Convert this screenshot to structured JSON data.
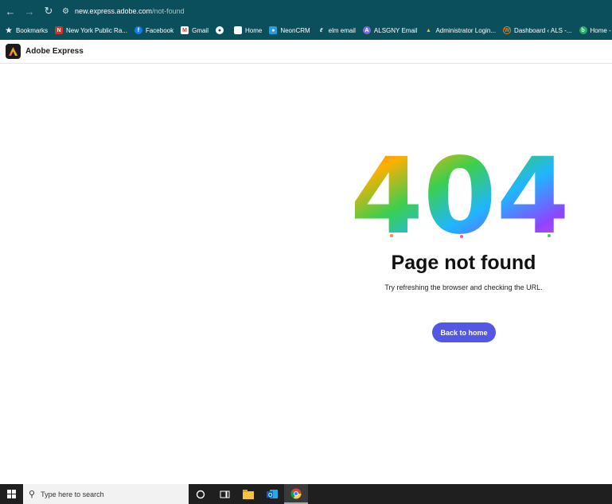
{
  "browser": {
    "url_host": "new.express.adobe.com",
    "url_path": "/not-found",
    "bookmarks": [
      {
        "label": "Bookmarks",
        "icon": "star-icon"
      },
      {
        "label": "New York Public Ra...",
        "icon": "nypr-icon"
      },
      {
        "label": "Facebook",
        "icon": "facebook-icon"
      },
      {
        "label": "Gmail",
        "icon": "gmail-icon"
      },
      {
        "label": "",
        "icon": "globe-icon"
      },
      {
        "label": "Home",
        "icon": "page-icon"
      },
      {
        "label": "NeonCRM",
        "icon": "neoncrm-icon"
      },
      {
        "label": "elm email",
        "icon": "elm-icon"
      },
      {
        "label": "ALSGNY Email",
        "icon": "alsgny-icon"
      },
      {
        "label": "Administrator Login...",
        "icon": "admin-icon"
      },
      {
        "label": "Dashboard ‹ ALS -...",
        "icon": "wordpress-icon"
      },
      {
        "label": "Home - Raiser's Edg...",
        "icon": "raisers-edge-icon"
      }
    ]
  },
  "app": {
    "name": "Adobe Express"
  },
  "page": {
    "code": "404",
    "title": "Page not found",
    "subtitle": "Try refreshing the browser and checking the URL.",
    "button_label": "Back to home"
  },
  "taskbar": {
    "search_placeholder": "Type here to search"
  },
  "colors": {
    "chrome_bg": "#0b4f5c",
    "accent_button": "#5258e4",
    "taskbar_bg": "#1f1f1f"
  }
}
